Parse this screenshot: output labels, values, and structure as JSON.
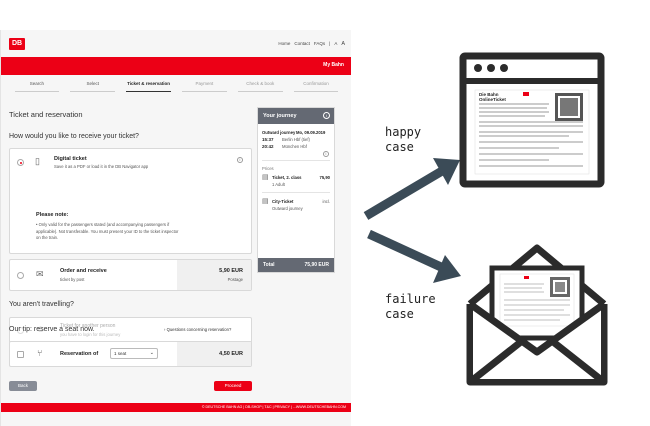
{
  "page": {
    "logo": "DB",
    "top_links": [
      "Home",
      "Contact",
      "FAQs",
      "|",
      "A",
      "A"
    ],
    "account": "My Bahn",
    "steps": [
      "Search",
      "Select",
      "Ticket & reservation",
      "Payment",
      "Check & book",
      "Confirmation"
    ],
    "title": "Ticket and reservation",
    "question": "How would you like to receive your ticket?",
    "digital": {
      "title": "Digital ticket",
      "subtitle": "Save it as a PDF or load it in the DB Navigator app",
      "note_title": "Please note:",
      "note_lines": [
        "•  Only valid for the passengers stated (and accompanying passengers if",
        "   applicable). Not transferable. You must present your ID to the ticket inspector",
        "   on the train."
      ]
    },
    "post": {
      "title": "Order and receive",
      "subtitle": "ticket by post",
      "price": "5,90 EUR",
      "price_label": "Postage"
    },
    "not_travelling": "You aren't travelling?",
    "another": {
      "title": "Ticket for another person",
      "subtitle": "you have to login for this journey"
    },
    "tip": "Our tip: reserve a seat now.",
    "tip_link": "Questions concerning reservation?",
    "reservation": {
      "label": "Reservation of",
      "select": "1 seat",
      "price": "4,50 EUR"
    },
    "back": "Back",
    "proceed": "Proceed",
    "footer": "© DEUTSCHE BAHN AG  |  DB-SHOP  |  T&C  |  PRIVACY  |  ...WWW.DEUTSCHEBAHN.COM"
  },
  "journey": {
    "title": "Your journey",
    "outward_label": "Outward journey",
    "date": "Mo, 09.09.2019",
    "dep_time": "15:37",
    "dep_station": "Berlin Hbf (tief)",
    "arr_time": "20:42",
    "arr_station": "München Hbf",
    "prices_label": "Prices",
    "ticket_line": "Ticket, 2. class",
    "ticket_price": "75,90",
    "adult": "1 Adult",
    "city_ticket": "City-Ticket",
    "city_value": "incl.",
    "city_sub": "Outward journey",
    "total_label": "Total",
    "total_value": "75,90 EUR"
  },
  "diagram": {
    "happy_line1": "happy",
    "happy_line2": "case",
    "failure_line1": "failure",
    "failure_line2": "case",
    "ticket_brand": "Die Bahn",
    "ticket_title": "OnlineTicket"
  },
  "colors": {
    "db_red": "#ec0016",
    "arrow": "#3b4b57",
    "icon_stroke": "#2b2b2b"
  }
}
